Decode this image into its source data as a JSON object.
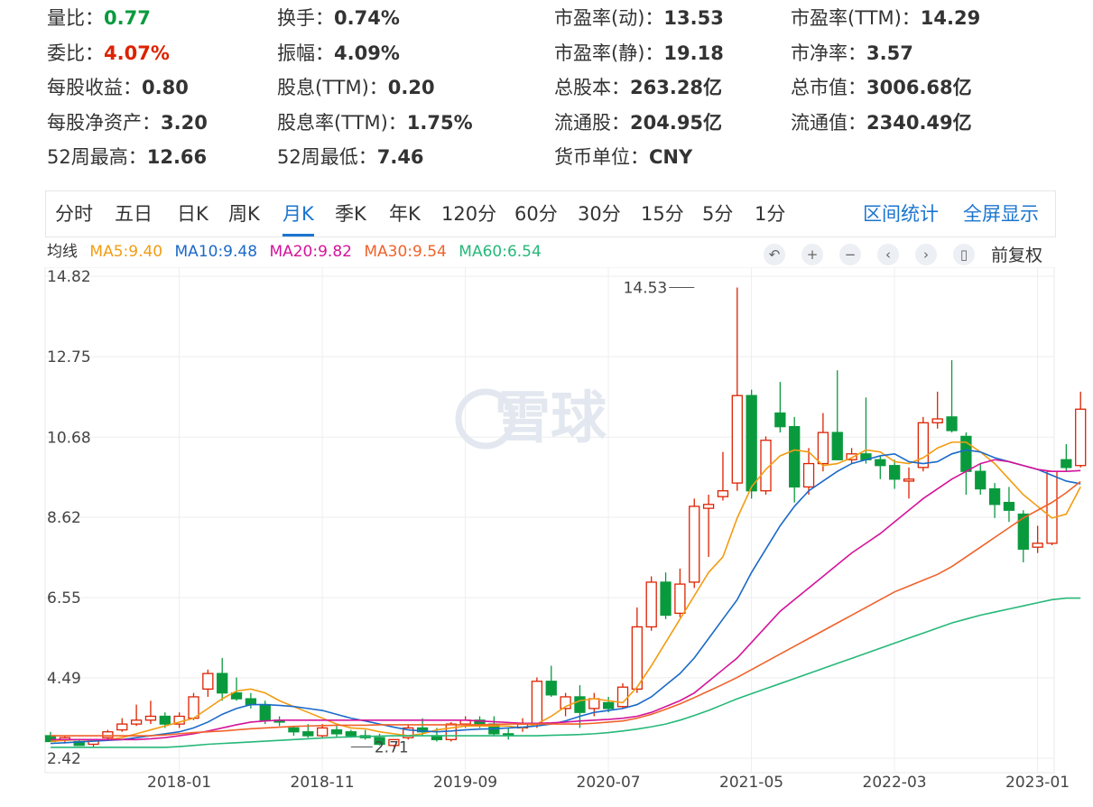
{
  "stats": [
    [
      {
        "label": "量比：",
        "value": "0.77",
        "tone": "down"
      },
      {
        "label": "委比：",
        "value": "4.07%",
        "tone": "up"
      },
      {
        "label": "每股收益：",
        "value": "0.80"
      },
      {
        "label": "每股净资产：",
        "value": "3.20"
      },
      {
        "label": "52周最高：",
        "value": "12.66"
      }
    ],
    [
      {
        "label": "换手：",
        "value": "0.74%"
      },
      {
        "label": "振幅：",
        "value": "4.09%"
      },
      {
        "label": "股息(TTM)：",
        "value": "0.20"
      },
      {
        "label": "股息率(TTM)：",
        "value": "1.75%"
      },
      {
        "label": "52周最低：",
        "value": "7.46"
      }
    ],
    [
      {
        "label": "市盈率(动)：",
        "value": "13.53"
      },
      {
        "label": "市盈率(静)：",
        "value": "19.18"
      },
      {
        "label": "总股本：",
        "value": "263.28亿"
      },
      {
        "label": "流通股：",
        "value": "204.95亿"
      },
      {
        "label": "货币单位：",
        "value": "CNY"
      }
    ],
    [
      {
        "label": "市盈率(TTM)：",
        "value": "14.29"
      },
      {
        "label": "市净率：",
        "value": "3.57"
      },
      {
        "label": "总市值：",
        "value": "3006.68亿"
      },
      {
        "label": "流通值：",
        "value": "2340.49亿"
      }
    ]
  ],
  "tabs": [
    "分时",
    "五日",
    "日K",
    "周K",
    "月K",
    "季K",
    "年K",
    "120分",
    "60分",
    "30分",
    "15分",
    "5分",
    "1分"
  ],
  "active_tab": "月K",
  "right_links": [
    "区间统计",
    "全屏显示"
  ],
  "ma_legend": {
    "title": "均线",
    "items": [
      {
        "label": "MA5:9.40",
        "color": "#f39c12"
      },
      {
        "label": "MA10:9.48",
        "color": "#1b6ac9"
      },
      {
        "label": "MA20:9.82",
        "color": "#d4149a"
      },
      {
        "label": "MA30:9.54",
        "color": "#f0622a"
      },
      {
        "label": "MA60:6.54",
        "color": "#26b879"
      }
    ]
  },
  "toolbar": {
    "icons": [
      "undo-icon",
      "zoom-in-icon",
      "zoom-out-icon",
      "chevron-left-icon",
      "chevron-right-icon",
      "candle-icon"
    ],
    "adjust_label": "前复权"
  },
  "watermark": "雪球",
  "colors": {
    "up": "#dd2200",
    "down": "#0a9a3e",
    "grid": "#eeeeee",
    "axis_text": "#444444"
  },
  "chart_data": {
    "type": "candlestick",
    "title": "",
    "xlabel": "",
    "ylabel": "",
    "ylim": [
      2.42,
      14.82
    ],
    "y_ticks": [
      14.82,
      12.75,
      10.68,
      8.62,
      6.55,
      4.49,
      2.42
    ],
    "x_ticks": [
      "2018-01",
      "2018-11",
      "2019-09",
      "2020-07",
      "2021-05",
      "2022-03",
      "2023-01"
    ],
    "x_tick_index": [
      9,
      19,
      29,
      39,
      49,
      59,
      69
    ],
    "annotations": [
      {
        "text": "14.53",
        "index": 45,
        "value": 14.53
      },
      {
        "text": "2.71",
        "index": 21,
        "value": 2.71
      }
    ],
    "candles": [
      {
        "o": 3.0,
        "h": 3.1,
        "l": 2.9,
        "c": 2.85
      },
      {
        "o": 2.9,
        "h": 3.0,
        "l": 2.8,
        "c": 2.95
      },
      {
        "o": 2.85,
        "h": 2.9,
        "l": 2.75,
        "c": 2.75
      },
      {
        "o": 2.78,
        "h": 2.9,
        "l": 2.7,
        "c": 2.9
      },
      {
        "o": 2.95,
        "h": 3.15,
        "l": 2.9,
        "c": 3.1
      },
      {
        "o": 3.15,
        "h": 3.45,
        "l": 3.1,
        "c": 3.3
      },
      {
        "o": 3.3,
        "h": 3.8,
        "l": 3.25,
        "c": 3.4
      },
      {
        "o": 3.4,
        "h": 3.9,
        "l": 3.3,
        "c": 3.5
      },
      {
        "o": 3.5,
        "h": 3.6,
        "l": 3.2,
        "c": 3.3
      },
      {
        "o": 3.3,
        "h": 3.6,
        "l": 3.2,
        "c": 3.5
      },
      {
        "o": 3.45,
        "h": 4.1,
        "l": 3.4,
        "c": 4.0
      },
      {
        "o": 4.2,
        "h": 4.7,
        "l": 4.0,
        "c": 4.6
      },
      {
        "o": 4.6,
        "h": 5.0,
        "l": 3.9,
        "c": 4.1
      },
      {
        "o": 4.1,
        "h": 4.5,
        "l": 3.9,
        "c": 3.95
      },
      {
        "o": 3.95,
        "h": 4.1,
        "l": 3.7,
        "c": 3.8
      },
      {
        "o": 3.8,
        "h": 3.9,
        "l": 3.3,
        "c": 3.4
      },
      {
        "o": 3.4,
        "h": 3.5,
        "l": 3.25,
        "c": 3.35
      },
      {
        "o": 3.2,
        "h": 3.25,
        "l": 3.0,
        "c": 3.1
      },
      {
        "o": 3.1,
        "h": 3.3,
        "l": 2.95,
        "c": 3.0
      },
      {
        "o": 3.0,
        "h": 3.3,
        "l": 2.95,
        "c": 3.2
      },
      {
        "o": 3.15,
        "h": 3.25,
        "l": 2.95,
        "c": 3.05
      },
      {
        "o": 3.1,
        "h": 3.15,
        "l": 2.95,
        "c": 3.0
      },
      {
        "o": 3.0,
        "h": 3.15,
        "l": 2.9,
        "c": 2.95
      },
      {
        "o": 2.95,
        "h": 3.05,
        "l": 2.75,
        "c": 2.78
      },
      {
        "o": 2.75,
        "h": 2.9,
        "l": 2.71,
        "c": 2.9
      },
      {
        "o": 2.95,
        "h": 3.3,
        "l": 2.9,
        "c": 3.2
      },
      {
        "o": 3.2,
        "h": 3.45,
        "l": 3.0,
        "c": 3.1
      },
      {
        "o": 3.0,
        "h": 3.2,
        "l": 2.85,
        "c": 2.9
      },
      {
        "o": 2.9,
        "h": 3.35,
        "l": 2.85,
        "c": 3.3
      },
      {
        "o": 3.3,
        "h": 3.5,
        "l": 3.2,
        "c": 3.4
      },
      {
        "o": 3.4,
        "h": 3.5,
        "l": 3.2,
        "c": 3.3
      },
      {
        "o": 3.3,
        "h": 3.5,
        "l": 3.0,
        "c": 3.05
      },
      {
        "o": 3.05,
        "h": 3.2,
        "l": 2.9,
        "c": 3.0
      },
      {
        "o": 3.2,
        "h": 3.45,
        "l": 3.1,
        "c": 3.3
      },
      {
        "o": 3.3,
        "h": 4.5,
        "l": 3.2,
        "c": 4.4
      },
      {
        "o": 4.4,
        "h": 4.8,
        "l": 4.0,
        "c": 4.05
      },
      {
        "o": 3.7,
        "h": 4.1,
        "l": 3.5,
        "c": 4.0
      },
      {
        "o": 4.0,
        "h": 4.3,
        "l": 3.2,
        "c": 3.6
      },
      {
        "o": 3.7,
        "h": 4.1,
        "l": 3.5,
        "c": 3.95
      },
      {
        "o": 3.85,
        "h": 4.0,
        "l": 3.6,
        "c": 3.7
      },
      {
        "o": 3.75,
        "h": 4.35,
        "l": 3.7,
        "c": 4.25
      },
      {
        "o": 4.2,
        "h": 6.3,
        "l": 4.1,
        "c": 5.8
      },
      {
        "o": 5.8,
        "h": 7.1,
        "l": 5.7,
        "c": 6.95
      },
      {
        "o": 6.95,
        "h": 7.2,
        "l": 6.0,
        "c": 6.1
      },
      {
        "o": 6.15,
        "h": 7.3,
        "l": 6.05,
        "c": 6.9
      },
      {
        "o": 6.95,
        "h": 9.1,
        "l": 6.8,
        "c": 8.9
      },
      {
        "o": 8.85,
        "h": 9.2,
        "l": 7.6,
        "c": 8.95
      },
      {
        "o": 9.15,
        "h": 10.3,
        "l": 9.05,
        "c": 9.3
      },
      {
        "o": 9.5,
        "h": 14.53,
        "l": 9.3,
        "c": 11.75
      },
      {
        "o": 11.75,
        "h": 11.9,
        "l": 9.1,
        "c": 9.3
      },
      {
        "o": 9.3,
        "h": 10.7,
        "l": 9.2,
        "c": 10.6
      },
      {
        "o": 11.3,
        "h": 12.1,
        "l": 10.8,
        "c": 10.95
      },
      {
        "o": 10.95,
        "h": 11.2,
        "l": 9.0,
        "c": 9.4
      },
      {
        "o": 9.4,
        "h": 10.4,
        "l": 9.2,
        "c": 10.0
      },
      {
        "o": 10.0,
        "h": 11.3,
        "l": 9.8,
        "c": 10.8
      },
      {
        "o": 10.8,
        "h": 12.4,
        "l": 10.7,
        "c": 10.1
      },
      {
        "o": 10.1,
        "h": 10.4,
        "l": 10.0,
        "c": 10.25
      },
      {
        "o": 10.25,
        "h": 11.7,
        "l": 10.0,
        "c": 10.1
      },
      {
        "o": 10.1,
        "h": 10.2,
        "l": 9.6,
        "c": 9.95
      },
      {
        "o": 9.95,
        "h": 10.1,
        "l": 9.35,
        "c": 9.6
      },
      {
        "o": 9.55,
        "h": 9.9,
        "l": 9.1,
        "c": 9.6
      },
      {
        "o": 9.9,
        "h": 11.2,
        "l": 9.8,
        "c": 11.05
      },
      {
        "o": 11.05,
        "h": 11.85,
        "l": 10.9,
        "c": 11.15
      },
      {
        "o": 11.2,
        "h": 12.66,
        "l": 10.8,
        "c": 10.85
      },
      {
        "o": 10.7,
        "h": 10.8,
        "l": 9.2,
        "c": 9.8
      },
      {
        "o": 9.8,
        "h": 10.0,
        "l": 9.2,
        "c": 9.35
      },
      {
        "o": 9.35,
        "h": 9.5,
        "l": 8.6,
        "c": 8.95
      },
      {
        "o": 9.0,
        "h": 9.4,
        "l": 8.5,
        "c": 8.8
      },
      {
        "o": 8.7,
        "h": 8.8,
        "l": 7.46,
        "c": 7.8
      },
      {
        "o": 7.85,
        "h": 8.4,
        "l": 7.7,
        "c": 7.95
      },
      {
        "o": 7.95,
        "h": 9.7,
        "l": 7.9,
        "c": 9.8
      },
      {
        "o": 10.1,
        "h": 10.5,
        "l": 9.8,
        "c": 9.9
      },
      {
        "o": 9.95,
        "h": 11.85,
        "l": 9.9,
        "c": 11.4
      }
    ],
    "series": [
      {
        "label": "MA5",
        "values": [
          2.85,
          2.88,
          2.9,
          2.88,
          2.9,
          2.95,
          3.05,
          3.15,
          3.25,
          3.35,
          3.45,
          3.7,
          3.95,
          4.15,
          4.2,
          4.1,
          3.9,
          3.75,
          3.6,
          3.45,
          3.3,
          3.2,
          3.18,
          3.1,
          3.05,
          3.0,
          3.05,
          3.15,
          3.2,
          3.25,
          3.25,
          3.25,
          3.25,
          3.2,
          3.3,
          3.5,
          3.75,
          3.9,
          3.95,
          3.9,
          3.85,
          4.25,
          4.8,
          5.4,
          6.0,
          6.6,
          7.2,
          7.6,
          8.6,
          9.4,
          9.85,
          10.2,
          10.35,
          10.3,
          9.95,
          10.0,
          10.15,
          10.35,
          10.3,
          10.05,
          10.0,
          10.15,
          10.4,
          10.55,
          10.55,
          10.3,
          10.0,
          9.6,
          9.2,
          8.9,
          8.6,
          8.7,
          9.4
        ]
      },
      {
        "label": "MA10",
        "values": [
          2.8,
          2.82,
          2.84,
          2.86,
          2.88,
          2.9,
          2.95,
          3.0,
          3.05,
          3.1,
          3.2,
          3.35,
          3.55,
          3.7,
          3.8,
          3.8,
          3.78,
          3.75,
          3.7,
          3.65,
          3.55,
          3.45,
          3.38,
          3.3,
          3.22,
          3.15,
          3.12,
          3.1,
          3.12,
          3.15,
          3.17,
          3.18,
          3.2,
          3.22,
          3.25,
          3.3,
          3.38,
          3.5,
          3.6,
          3.65,
          3.7,
          3.8,
          4.0,
          4.3,
          4.6,
          5.0,
          5.5,
          6.0,
          6.5,
          7.2,
          7.8,
          8.4,
          8.9,
          9.3,
          9.55,
          9.8,
          10.0,
          10.1,
          10.2,
          10.25,
          10.05,
          10.0,
          10.05,
          10.25,
          10.35,
          10.3,
          10.15,
          10.05,
          9.95,
          9.85,
          9.7,
          9.55,
          9.48
        ]
      },
      {
        "label": "MA20",
        "values": [
          2.9,
          2.9,
          2.9,
          2.9,
          2.9,
          2.9,
          2.9,
          2.92,
          2.95,
          3.0,
          3.05,
          3.12,
          3.2,
          3.28,
          3.35,
          3.38,
          3.4,
          3.4,
          3.4,
          3.4,
          3.4,
          3.4,
          3.4,
          3.4,
          3.4,
          3.4,
          3.4,
          3.4,
          3.4,
          3.4,
          3.38,
          3.36,
          3.34,
          3.32,
          3.32,
          3.33,
          3.35,
          3.38,
          3.4,
          3.42,
          3.45,
          3.5,
          3.6,
          3.75,
          3.9,
          4.1,
          4.4,
          4.7,
          5.0,
          5.4,
          5.8,
          6.2,
          6.5,
          6.8,
          7.1,
          7.4,
          7.7,
          7.95,
          8.2,
          8.5,
          8.8,
          9.1,
          9.35,
          9.6,
          9.8,
          10.0,
          10.1,
          10.05,
          9.95,
          9.85,
          9.8,
          9.8,
          9.82
        ]
      },
      {
        "label": "MA30",
        "values": [
          3.0,
          3.0,
          3.0,
          3.0,
          3.0,
          3.0,
          3.0,
          3.0,
          3.02,
          3.05,
          3.08,
          3.1,
          3.12,
          3.15,
          3.18,
          3.2,
          3.22,
          3.24,
          3.25,
          3.26,
          3.27,
          3.27,
          3.27,
          3.28,
          3.28,
          3.28,
          3.28,
          3.28,
          3.28,
          3.28,
          3.28,
          3.29,
          3.3,
          3.3,
          3.3,
          3.3,
          3.3,
          3.3,
          3.32,
          3.35,
          3.38,
          3.45,
          3.55,
          3.68,
          3.82,
          3.98,
          4.15,
          4.32,
          4.5,
          4.7,
          4.9,
          5.1,
          5.3,
          5.5,
          5.7,
          5.9,
          6.1,
          6.3,
          6.5,
          6.7,
          6.85,
          7.0,
          7.15,
          7.35,
          7.6,
          7.85,
          8.1,
          8.35,
          8.6,
          8.8,
          9.0,
          9.25,
          9.54
        ]
      },
      {
        "label": "MA60",
        "values": [
          2.7,
          2.7,
          2.7,
          2.7,
          2.7,
          2.7,
          2.7,
          2.7,
          2.7,
          2.72,
          2.75,
          2.78,
          2.8,
          2.82,
          2.84,
          2.86,
          2.88,
          2.9,
          2.92,
          2.94,
          2.96,
          2.97,
          2.98,
          2.99,
          3.0,
          3.0,
          3.0,
          3.0,
          3.0,
          3.0,
          3.0,
          3.0,
          3.0,
          3.0,
          3.0,
          3.01,
          3.02,
          3.03,
          3.05,
          3.08,
          3.12,
          3.17,
          3.23,
          3.3,
          3.4,
          3.52,
          3.65,
          3.8,
          3.95,
          4.08,
          4.21,
          4.34,
          4.47,
          4.6,
          4.73,
          4.86,
          4.99,
          5.12,
          5.25,
          5.38,
          5.51,
          5.64,
          5.77,
          5.9,
          6.0,
          6.1,
          6.18,
          6.26,
          6.34,
          6.42,
          6.5,
          6.54,
          6.54
        ]
      }
    ]
  }
}
